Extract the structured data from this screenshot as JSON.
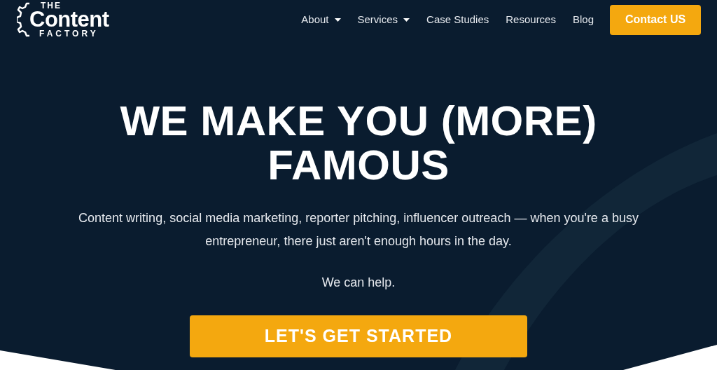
{
  "logo": {
    "line_1": "THE",
    "line_2": "Content",
    "line_3": "FACTORY"
  },
  "nav": [
    {
      "label": "About",
      "dropdown": true
    },
    {
      "label": "Services",
      "dropdown": true
    },
    {
      "label": "Case Studies",
      "dropdown": false
    },
    {
      "label": "Resources",
      "dropdown": false
    },
    {
      "label": "Blog",
      "dropdown": false
    }
  ],
  "contact_button": "Contact US",
  "hero": {
    "title": "WE MAKE YOU (MORE) FAMOUS",
    "subtitle": "Content writing, social media marketing, reporter pitching, influencer outreach — when you're a busy entrepreneur, there just aren't enough hours in the day.",
    "note": "We can help.",
    "cta": "LET'S GET STARTED"
  }
}
